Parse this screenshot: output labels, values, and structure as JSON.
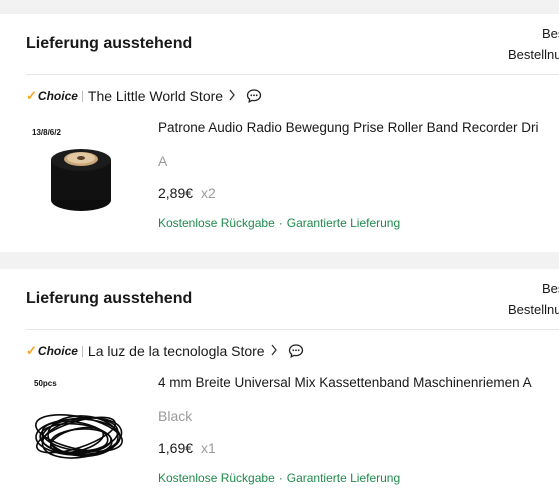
{
  "orders": [
    {
      "status": "Lieferung ausstehend",
      "right_line1": "Bes",
      "right_line2": "Bestellnu",
      "choice_label": "Choice",
      "store_name": "The Little World Store",
      "thumb_label": "13/8/6/2",
      "product_title": "Patrone Audio Radio Bewegung Prise Roller Band Recorder Dri",
      "variant": "A",
      "price": "2,89€",
      "quantity": "x2",
      "perk1": "Kostenlose Rückgabe",
      "perk_sep": "·",
      "perk2": "Garantierte Lieferung",
      "icon": "pinch-roller-image"
    },
    {
      "status": "Lieferung ausstehend",
      "right_line1": "Bes",
      "right_line2": "Bestellnu",
      "choice_label": "Choice",
      "store_name": "La luz de la tecnologla Store",
      "thumb_label": "50pcs",
      "product_title": "4 mm Breite Universal Mix Kassettenband Maschinenriemen A",
      "variant": "Black",
      "price": "1,69€",
      "quantity": "x1",
      "perk1": "Kostenlose Rückgabe",
      "perk_sep": "·",
      "perk2": "Garantierte Lieferung",
      "icon": "rubber-belts-image"
    }
  ],
  "colors": {
    "accent_green": "#1f8a4c",
    "choice_check": "#f5a623",
    "muted": "#9b9b9b",
    "background": "#f2f2f2"
  }
}
